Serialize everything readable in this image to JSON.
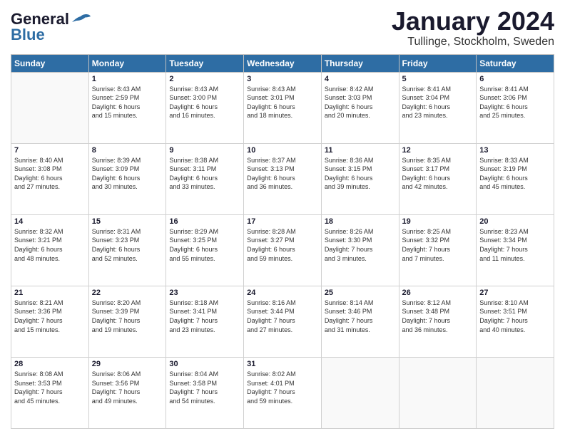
{
  "logo": {
    "line1": "General",
    "line2": "Blue"
  },
  "title": "January 2024",
  "subtitle": "Tullinge, Stockholm, Sweden",
  "weekdays": [
    "Sunday",
    "Monday",
    "Tuesday",
    "Wednesday",
    "Thursday",
    "Friday",
    "Saturday"
  ],
  "weeks": [
    [
      {
        "day": null
      },
      {
        "day": "1",
        "sunrise": "8:43 AM",
        "sunset": "2:59 PM",
        "daylight": "6 hours and 15 minutes."
      },
      {
        "day": "2",
        "sunrise": "8:43 AM",
        "sunset": "3:00 PM",
        "daylight": "6 hours and 16 minutes."
      },
      {
        "day": "3",
        "sunrise": "8:43 AM",
        "sunset": "3:01 PM",
        "daylight": "6 hours and 18 minutes."
      },
      {
        "day": "4",
        "sunrise": "8:42 AM",
        "sunset": "3:03 PM",
        "daylight": "6 hours and 20 minutes."
      },
      {
        "day": "5",
        "sunrise": "8:41 AM",
        "sunset": "3:04 PM",
        "daylight": "6 hours and 23 minutes."
      },
      {
        "day": "6",
        "sunrise": "8:41 AM",
        "sunset": "3:06 PM",
        "daylight": "6 hours and 25 minutes."
      }
    ],
    [
      {
        "day": "7",
        "sunrise": "8:40 AM",
        "sunset": "3:08 PM",
        "daylight": "6 hours and 27 minutes."
      },
      {
        "day": "8",
        "sunrise": "8:39 AM",
        "sunset": "3:09 PM",
        "daylight": "6 hours and 30 minutes."
      },
      {
        "day": "9",
        "sunrise": "8:38 AM",
        "sunset": "3:11 PM",
        "daylight": "6 hours and 33 minutes."
      },
      {
        "day": "10",
        "sunrise": "8:37 AM",
        "sunset": "3:13 PM",
        "daylight": "6 hours and 36 minutes."
      },
      {
        "day": "11",
        "sunrise": "8:36 AM",
        "sunset": "3:15 PM",
        "daylight": "6 hours and 39 minutes."
      },
      {
        "day": "12",
        "sunrise": "8:35 AM",
        "sunset": "3:17 PM",
        "daylight": "6 hours and 42 minutes."
      },
      {
        "day": "13",
        "sunrise": "8:33 AM",
        "sunset": "3:19 PM",
        "daylight": "6 hours and 45 minutes."
      }
    ],
    [
      {
        "day": "14",
        "sunrise": "8:32 AM",
        "sunset": "3:21 PM",
        "daylight": "6 hours and 48 minutes."
      },
      {
        "day": "15",
        "sunrise": "8:31 AM",
        "sunset": "3:23 PM",
        "daylight": "6 hours and 52 minutes."
      },
      {
        "day": "16",
        "sunrise": "8:29 AM",
        "sunset": "3:25 PM",
        "daylight": "6 hours and 55 minutes."
      },
      {
        "day": "17",
        "sunrise": "8:28 AM",
        "sunset": "3:27 PM",
        "daylight": "6 hours and 59 minutes."
      },
      {
        "day": "18",
        "sunrise": "8:26 AM",
        "sunset": "3:30 PM",
        "daylight": "7 hours and 3 minutes."
      },
      {
        "day": "19",
        "sunrise": "8:25 AM",
        "sunset": "3:32 PM",
        "daylight": "7 hours and 7 minutes."
      },
      {
        "day": "20",
        "sunrise": "8:23 AM",
        "sunset": "3:34 PM",
        "daylight": "7 hours and 11 minutes."
      }
    ],
    [
      {
        "day": "21",
        "sunrise": "8:21 AM",
        "sunset": "3:36 PM",
        "daylight": "7 hours and 15 minutes."
      },
      {
        "day": "22",
        "sunrise": "8:20 AM",
        "sunset": "3:39 PM",
        "daylight": "7 hours and 19 minutes."
      },
      {
        "day": "23",
        "sunrise": "8:18 AM",
        "sunset": "3:41 PM",
        "daylight": "7 hours and 23 minutes."
      },
      {
        "day": "24",
        "sunrise": "8:16 AM",
        "sunset": "3:44 PM",
        "daylight": "7 hours and 27 minutes."
      },
      {
        "day": "25",
        "sunrise": "8:14 AM",
        "sunset": "3:46 PM",
        "daylight": "7 hours and 31 minutes."
      },
      {
        "day": "26",
        "sunrise": "8:12 AM",
        "sunset": "3:48 PM",
        "daylight": "7 hours and 36 minutes."
      },
      {
        "day": "27",
        "sunrise": "8:10 AM",
        "sunset": "3:51 PM",
        "daylight": "7 hours and 40 minutes."
      }
    ],
    [
      {
        "day": "28",
        "sunrise": "8:08 AM",
        "sunset": "3:53 PM",
        "daylight": "7 hours and 45 minutes."
      },
      {
        "day": "29",
        "sunrise": "8:06 AM",
        "sunset": "3:56 PM",
        "daylight": "7 hours and 49 minutes."
      },
      {
        "day": "30",
        "sunrise": "8:04 AM",
        "sunset": "3:58 PM",
        "daylight": "7 hours and 54 minutes."
      },
      {
        "day": "31",
        "sunrise": "8:02 AM",
        "sunset": "4:01 PM",
        "daylight": "7 hours and 59 minutes."
      },
      {
        "day": null
      },
      {
        "day": null
      },
      {
        "day": null
      }
    ]
  ]
}
